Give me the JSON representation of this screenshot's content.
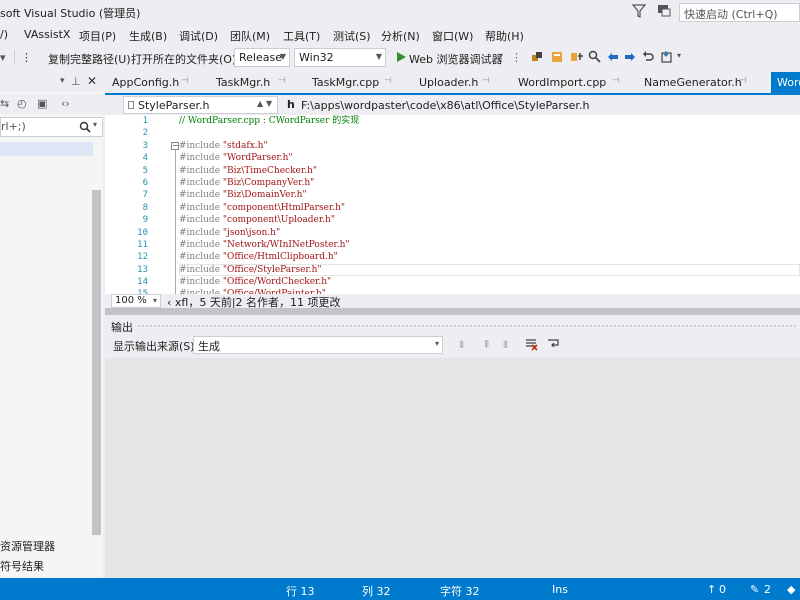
{
  "titlebar": {
    "title": "soft Visual Studio (管理员)",
    "quicklaunch_placeholder": "快速启动 (Ctrl+Q)"
  },
  "menu": [
    {
      "label": "/)"
    },
    {
      "label": "VAssistX"
    },
    {
      "label": "项目(P)"
    },
    {
      "label": "生成(B)"
    },
    {
      "label": "调试(D)"
    },
    {
      "label": "团队(M)"
    },
    {
      "label": "工具(T)"
    },
    {
      "label": "测试(S)"
    },
    {
      "label": "分析(N)"
    },
    {
      "label": "窗口(W)"
    },
    {
      "label": "帮助(H)"
    }
  ],
  "toolbar": {
    "copy_path": "复制完整路径(U)",
    "open_folder": "打开所在的文件夹(O)",
    "config": "Release",
    "platform": "Win32",
    "run": "Web 浏览器调试器"
  },
  "leftpanel": {
    "search_text": "rl+;)",
    "tab_solution": "资源管理器",
    "tab_find": "符号结果"
  },
  "tabs": [
    {
      "label": "AppConfig.h"
    },
    {
      "label": "TaskMgr.h"
    },
    {
      "label": "TaskMgr.cpp"
    },
    {
      "label": "Uploader.h"
    },
    {
      "label": "WordImport.cpp"
    },
    {
      "label": "NameGenerator.h"
    }
  ],
  "active_tab": "WordParser.cpp",
  "navbar": {
    "file": "StyleParser.h",
    "h_label": "h",
    "path": "F:\\apps\\wordpaster\\code\\x86\\atl\\Office\\StyleParser.h"
  },
  "editor": {
    "lines": [
      {
        "n": "1",
        "text": "// WordParser.cpp : CWordParser 的实现"
      },
      {
        "n": "2",
        "text": ""
      },
      {
        "n": "3",
        "text": "#include \"stdafx.h\""
      },
      {
        "n": "4",
        "text": "#include \"WordParser.h\""
      },
      {
        "n": "5",
        "text": "#include \"Biz\\TimeChecker.h\""
      },
      {
        "n": "6",
        "text": "#include \"Biz\\CompanyVer.h\""
      },
      {
        "n": "7",
        "text": "#include \"Biz\\DomainVer.h\""
      },
      {
        "n": "8",
        "text": "#include \"component\\HtmlParser.h\""
      },
      {
        "n": "9",
        "text": "#include \"component\\Uploader.h\""
      },
      {
        "n": "10",
        "text": "#include \"json\\json.h\""
      },
      {
        "n": "11",
        "text": "#include \"Network/WInINetPoster.h\""
      },
      {
        "n": "12",
        "text": "#include \"Office/HtmlClipboard.h\""
      },
      {
        "n": "13",
        "text": "#include \"Office/StyleParser.h\""
      },
      {
        "n": "14",
        "text": "#include \"Office/WordChecker.h\""
      },
      {
        "n": "15",
        "text": "#include \"Office/WordPainter.h\""
      }
    ]
  },
  "edstatus": {
    "zoom": "100 %",
    "codelens": "xfl，5 天前|2 名作者，11 项更改"
  },
  "output": {
    "title": "输出",
    "label": "显示输出来源(S):",
    "source": "生成"
  },
  "statusbar": {
    "row": "行 13",
    "col": "列 32",
    "char": "字符 32",
    "ins": "Ins",
    "up": "0",
    "pencil": "2"
  },
  "colors": {
    "accent": "#007acc",
    "bg": "#eeeef2"
  }
}
